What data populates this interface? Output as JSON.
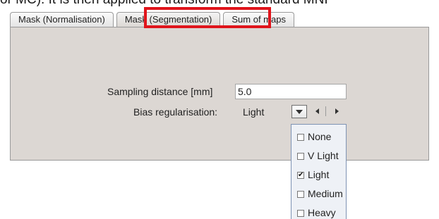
{
  "document": {
    "top_text": "or MC). It is then applied to transform the standard MNI"
  },
  "tabs": [
    {
      "label": "Mask (Normalisation)",
      "active": false
    },
    {
      "label": "Mask (Segmentation)",
      "active": true
    },
    {
      "label": "Sum of maps",
      "active": false
    }
  ],
  "highlight_color": "#e0141b",
  "form": {
    "sampling_label": "Sampling distance [mm]",
    "sampling_value": "5.0",
    "bias_label": "Bias regularisation:",
    "bias_value": "Light"
  },
  "icons": {
    "dropdown": "dropdown-arrow-icon",
    "left": "arrow-left-icon",
    "right": "arrow-right-icon"
  },
  "menu": {
    "options": [
      {
        "label": "None",
        "checked": false
      },
      {
        "label": "V Light",
        "checked": false
      },
      {
        "label": "Light",
        "checked": true
      },
      {
        "label": "Medium",
        "checked": false
      },
      {
        "label": "Heavy",
        "checked": false
      }
    ],
    "check_glyph": "✔"
  },
  "colors": {
    "panel": "#dcd7d3",
    "menu_bg": "#eef1f6",
    "menu_border": "#7e93b4"
  }
}
